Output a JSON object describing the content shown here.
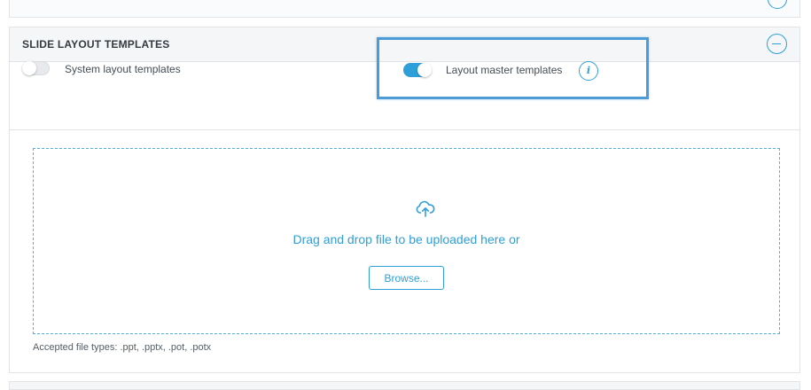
{
  "section": {
    "title": "SLIDE LAYOUT TEMPLATES"
  },
  "toggles": {
    "system": {
      "label": "System layout templates",
      "enabled": false
    },
    "master": {
      "label": "Layout master templates",
      "enabled": true
    },
    "info_icon": "i"
  },
  "upload": {
    "icon": "cloud-upload-icon",
    "prompt": "Drag and drop file to be uploaded here or",
    "browse_label": "Browse...",
    "accepted_types": "Accepted file types: .ppt, .pptx, .pot, .potx"
  },
  "colors": {
    "accent": "#2e9fd8",
    "highlight": "#4d9bd6"
  }
}
